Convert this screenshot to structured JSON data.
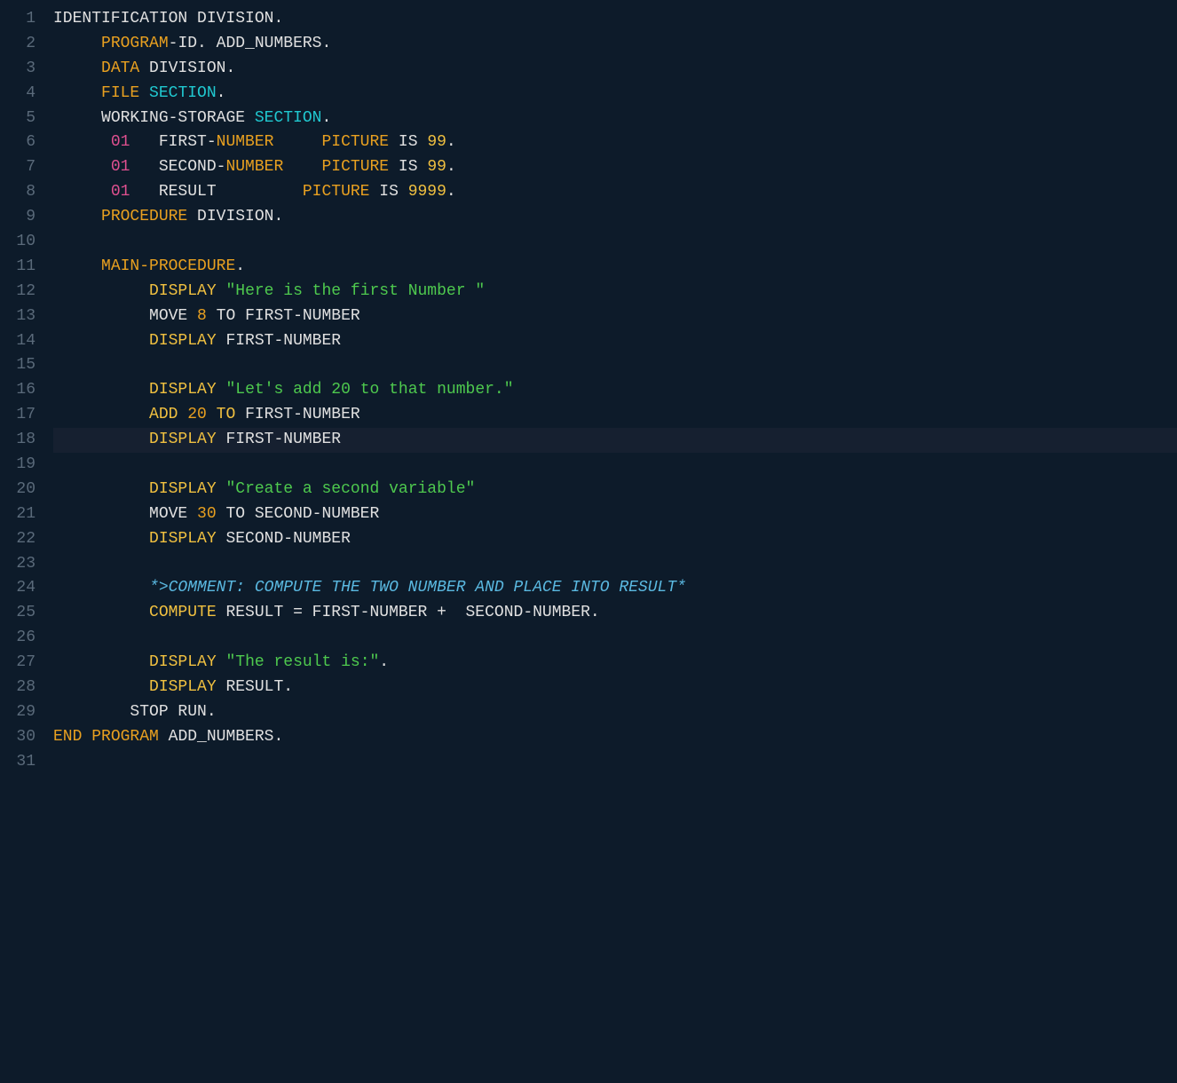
{
  "editor": {
    "background": "#0d1b2a",
    "lines": [
      {
        "num": 1,
        "highlighted": false
      },
      {
        "num": 2,
        "highlighted": false
      },
      {
        "num": 3,
        "highlighted": false
      },
      {
        "num": 4,
        "highlighted": false
      },
      {
        "num": 5,
        "highlighted": false
      },
      {
        "num": 6,
        "highlighted": false
      },
      {
        "num": 7,
        "highlighted": false
      },
      {
        "num": 8,
        "highlighted": false
      },
      {
        "num": 9,
        "highlighted": false
      },
      {
        "num": 10,
        "highlighted": false
      },
      {
        "num": 11,
        "highlighted": false
      },
      {
        "num": 12,
        "highlighted": false
      },
      {
        "num": 13,
        "highlighted": false
      },
      {
        "num": 14,
        "highlighted": false
      },
      {
        "num": 15,
        "highlighted": false
      },
      {
        "num": 16,
        "highlighted": false
      },
      {
        "num": 17,
        "highlighted": false
      },
      {
        "num": 18,
        "highlighted": true
      },
      {
        "num": 19,
        "highlighted": false
      },
      {
        "num": 20,
        "highlighted": false
      },
      {
        "num": 21,
        "highlighted": false
      },
      {
        "num": 22,
        "highlighted": false
      },
      {
        "num": 23,
        "highlighted": false
      },
      {
        "num": 24,
        "highlighted": false
      },
      {
        "num": 25,
        "highlighted": false
      },
      {
        "num": 26,
        "highlighted": false
      },
      {
        "num": 27,
        "highlighted": false
      },
      {
        "num": 28,
        "highlighted": false
      },
      {
        "num": 29,
        "highlighted": false
      },
      {
        "num": 30,
        "highlighted": false
      },
      {
        "num": 31,
        "highlighted": false
      }
    ]
  }
}
